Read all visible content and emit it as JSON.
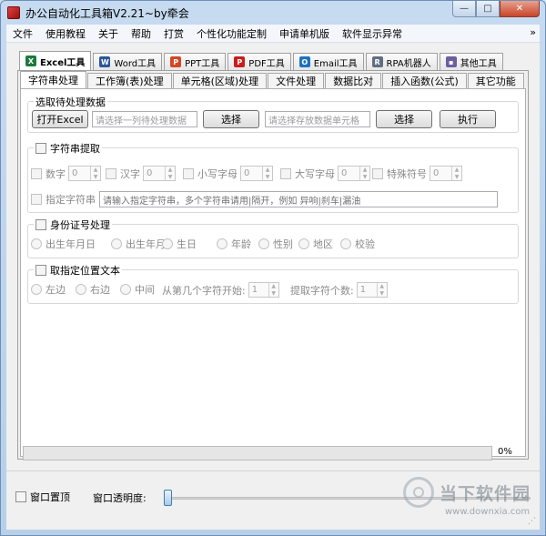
{
  "window": {
    "title": "办公自动化工具箱V2.21~by牵会",
    "controls": [
      "—",
      "□",
      "✕"
    ]
  },
  "menu": {
    "items": [
      "文件",
      "使用教程",
      "关于",
      "帮助",
      "打赏",
      "个性化功能定制",
      "申请单机版",
      "软件显示异常"
    ],
    "overflow": "»"
  },
  "outer_tabs": [
    {
      "label": "Excel工具",
      "icon": "excel-icon",
      "color": "#1d7a3c",
      "glyph": "X"
    },
    {
      "label": "Word工具",
      "icon": "word-icon",
      "color": "#2b5797",
      "glyph": "W"
    },
    {
      "label": "PPT工具",
      "icon": "ppt-icon",
      "color": "#d24726",
      "glyph": "P"
    },
    {
      "label": "PDF工具",
      "icon": "pdf-icon",
      "color": "#c81d1d",
      "glyph": "P"
    },
    {
      "label": "Email工具",
      "icon": "email-icon",
      "color": "#1e73be",
      "glyph": "O"
    },
    {
      "label": "RPA机器人",
      "icon": "robot-icon",
      "color": "#5f6f7f",
      "glyph": "R"
    },
    {
      "label": "其他工具",
      "icon": "folder-icon",
      "color": "#6b5fa0",
      "glyph": "▪"
    }
  ],
  "inner_tabs": [
    "字符串处理",
    "工作簿(表)处理",
    "单元格(区域)处理",
    "文件处理",
    "数据比对",
    "插入函数(公式)",
    "其它功能"
  ],
  "select_group": {
    "title": "选取待处理数据",
    "open_excel": "打开Excel",
    "source_placeholder": "请选择一列待处理数据",
    "select1": "选择",
    "target_placeholder": "请选择存放数据单元格",
    "select2": "选择",
    "run": "执行"
  },
  "string_group": {
    "title": "字符串提取",
    "options": [
      {
        "label": "数字",
        "value": "0"
      },
      {
        "label": "汉字",
        "value": "0"
      },
      {
        "label": "小写字母",
        "value": "0"
      },
      {
        "label": "大写字母",
        "value": "0"
      },
      {
        "label": "特殊符号",
        "value": "0"
      }
    ],
    "specify_label": "指定字符串",
    "specify_placeholder": "请输入指定字符串，多个字符串请用|隔开，例如 异响|刹车|漏油"
  },
  "id_group": {
    "title": "身份证号处理",
    "options": [
      "出生年月日",
      "出生年月",
      "生日",
      "年龄",
      "性别",
      "地区",
      "校验"
    ]
  },
  "pos_group": {
    "title": "取指定位置文本",
    "options": [
      "左边",
      "右边",
      "中间"
    ],
    "start_label": "从第几个字符开始:",
    "start_value": "1",
    "count_label": "提取字符个数:",
    "count_value": "1"
  },
  "progress": {
    "value": 0,
    "label": "0%"
  },
  "bottom": {
    "topmost_label": "窗口置顶",
    "opacity_label": "窗口透明度:",
    "opacity_value": 0
  },
  "watermark": {
    "text": "当下软件园",
    "url": "www.downxia.com"
  }
}
